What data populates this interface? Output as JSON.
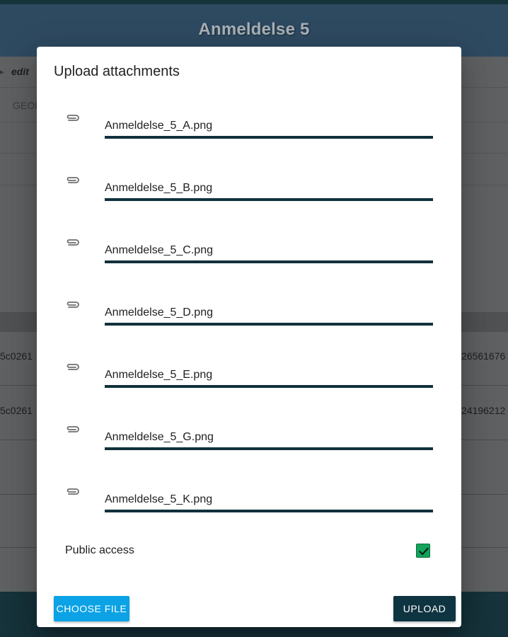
{
  "page": {
    "title": "Anmeldelse 5",
    "breadcrumb_edit": "edit",
    "tab_label": "GEOI",
    "row_fragments": [
      {
        "left": "5c0261",
        "right": "26561676"
      },
      {
        "left": "5c0261",
        "right": "24196212"
      }
    ]
  },
  "dialog": {
    "title": "Upload attachments",
    "files": [
      {
        "name": "Anmeldelse_5_A.png",
        "icon": "paperclip-icon"
      },
      {
        "name": "Anmeldelse_5_B.png",
        "icon": "paperclip-icon"
      },
      {
        "name": "Anmeldelse_5_C.png",
        "icon": "paperclip-icon"
      },
      {
        "name": "Anmeldelse_5_D.png",
        "icon": "paperclip-icon"
      },
      {
        "name": "Anmeldelse_5_E.png",
        "icon": "paperclip-icon"
      },
      {
        "name": "Anmeldelse_5_G.png",
        "icon": "paperclip-icon"
      },
      {
        "name": "Anmeldelse_5_K.png",
        "icon": "paperclip-icon"
      }
    ],
    "public_access_label": "Public access",
    "public_access_checked": true,
    "choose_file_label": "CHOOSE FILE",
    "upload_label": "UPLOAD"
  },
  "colors": {
    "title_bar": "#2e4a61",
    "underline": "#10313c",
    "choose_button": "#0ba2e6",
    "upload_button": "#0f3441",
    "checkbox": "#13a35c"
  }
}
